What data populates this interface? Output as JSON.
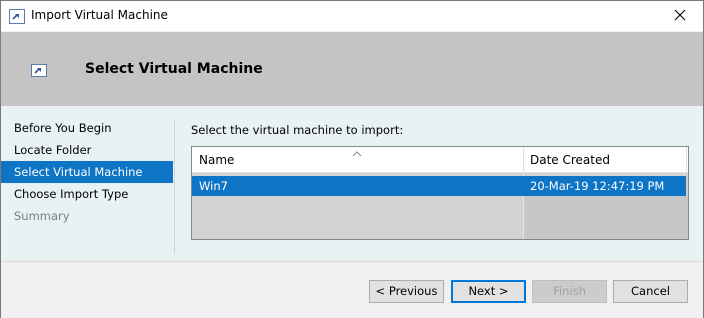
{
  "window": {
    "title": "Import Virtual Machine",
    "icon": "import-vm-icon"
  },
  "header": {
    "title": "Select Virtual Machine",
    "icon": "import-vm-icon"
  },
  "nav": {
    "items": [
      {
        "label": "Before You Begin",
        "state": "normal"
      },
      {
        "label": "Locate Folder",
        "state": "normal"
      },
      {
        "label": "Select Virtual Machine",
        "state": "selected"
      },
      {
        "label": "Choose Import Type",
        "state": "normal"
      },
      {
        "label": "Summary",
        "state": "disabled"
      }
    ]
  },
  "main": {
    "prompt": "Select the virtual machine to import:",
    "table": {
      "columns": [
        "Name",
        "Date Created"
      ],
      "sorted_column": "Name",
      "rows": [
        {
          "name": "Win7",
          "date_created": "20-Mar-19 12:47:19 PM",
          "selected": true
        }
      ]
    }
  },
  "footer": {
    "previous_label": "< Previous",
    "next_label": "Next >",
    "finish_label": "Finish",
    "cancel_label": "Cancel",
    "finish_enabled": false
  },
  "colors": {
    "selection": "#0e74c6",
    "header_band": "#c4c4c4",
    "content_bg": "#e9f2f3",
    "default_button_border": "#0078d7"
  }
}
